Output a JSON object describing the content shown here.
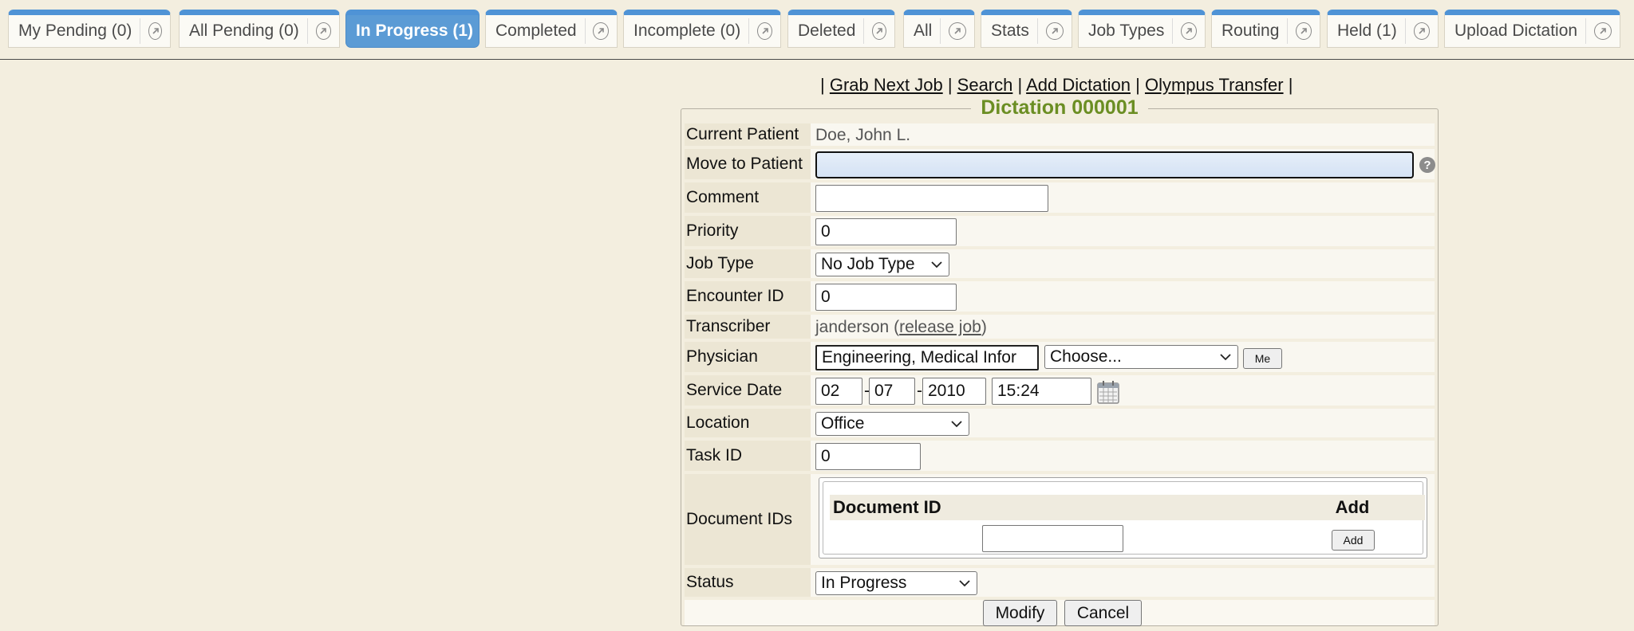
{
  "tabs": [
    {
      "label": "My Pending (0)",
      "active": false
    },
    {
      "label": "All Pending (0)",
      "active": false
    },
    {
      "label": "In Progress (1)",
      "active": true
    },
    {
      "label": "Completed",
      "active": false
    },
    {
      "label": "Incomplete (0)",
      "active": false
    },
    {
      "label": "Deleted",
      "active": false
    },
    {
      "label": "All",
      "active": false
    },
    {
      "label": "Stats",
      "active": false
    },
    {
      "label": "Job Types",
      "active": false
    },
    {
      "label": "Routing",
      "active": false
    },
    {
      "label": "Held (1)",
      "active": false
    },
    {
      "label": "Upload Dictation",
      "active": false
    }
  ],
  "links": {
    "grab_next": "Grab Next Job",
    "search": "Search",
    "add_dictation": "Add Dictation",
    "olympus": "Olympus Transfer",
    "sep": "|"
  },
  "form": {
    "title": "Dictation 000001",
    "labels": {
      "current_patient": "Current Patient",
      "move_to_patient": "Move to Patient",
      "comment": "Comment",
      "priority": "Priority",
      "job_type": "Job Type",
      "encounter_id": "Encounter ID",
      "transcriber": "Transcriber",
      "physician": "Physician",
      "service_date": "Service Date",
      "location": "Location",
      "task_id": "Task ID",
      "document_ids": "Document IDs",
      "status": "Status"
    },
    "current_patient": "Doe, John L.",
    "move_to_patient": "",
    "comment": "",
    "priority": "0",
    "job_type": "No Job Type",
    "encounter_id": "0",
    "transcriber": {
      "name": "janderson",
      "open": "(",
      "link": "release job",
      "close": ")"
    },
    "physician": {
      "value": "Engineering, Medical Infor",
      "choose": "Choose...",
      "me_button": "Me"
    },
    "service_date": {
      "month": "02",
      "day": "07",
      "year": "2010",
      "time": "15:24",
      "sep": "-"
    },
    "location": "Office",
    "task_id": "0",
    "documents": {
      "col_id": "Document ID",
      "col_add": "Add",
      "input": "",
      "add_button": "Add"
    },
    "status": "In Progress",
    "buttons": {
      "modify": "Modify",
      "cancel": "Cancel"
    },
    "help_glyph": "?"
  },
  "colors": {
    "tab_accent": "#4f93d6",
    "active_tab": "#5b9bd5",
    "title": "#6b8e23",
    "background": "#f3eedf",
    "focus_input": "#dbe6f4"
  }
}
